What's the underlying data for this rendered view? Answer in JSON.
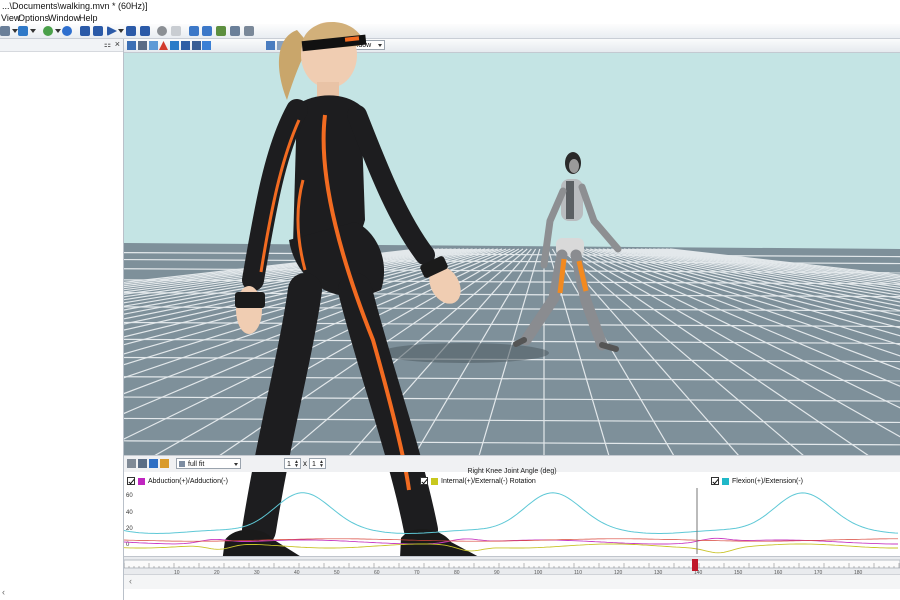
{
  "window": {
    "title": "...\\Documents\\walking.mvn * (60Hz)]"
  },
  "menu": {
    "items": [
      "View",
      "Options",
      "Window",
      "Help"
    ]
  },
  "viewport_toolbar": {
    "window_select": "1 window"
  },
  "graph_panel": {
    "fit_select": "full fit",
    "spin_a": "1",
    "spin_b": "1",
    "spin_sep": "x",
    "title": "Right Knee Joint Angle (deg)",
    "legend": [
      {
        "label": "Abduction(+)/Adduction(-)",
        "color": "#c026c0"
      },
      {
        "label": "Internal(+)/External(-) Rotation",
        "color": "#c8c81e"
      },
      {
        "label": "Flexion(+)/Extension(-)",
        "color": "#20b8c8"
      }
    ],
    "y_ticks": [
      "60",
      "40",
      "20",
      "0"
    ]
  },
  "timeline": {
    "ticks": [
      "10",
      "20",
      "30",
      "40",
      "50",
      "60",
      "70",
      "80",
      "90",
      "100",
      "110",
      "120",
      "130",
      "140",
      "150",
      "160",
      "170",
      "180"
    ]
  },
  "colors": {
    "sky": "#c4e4e4",
    "floor": "#7e909a",
    "accent_orange": "#f26b21",
    "playhead": "#c0182a"
  }
}
